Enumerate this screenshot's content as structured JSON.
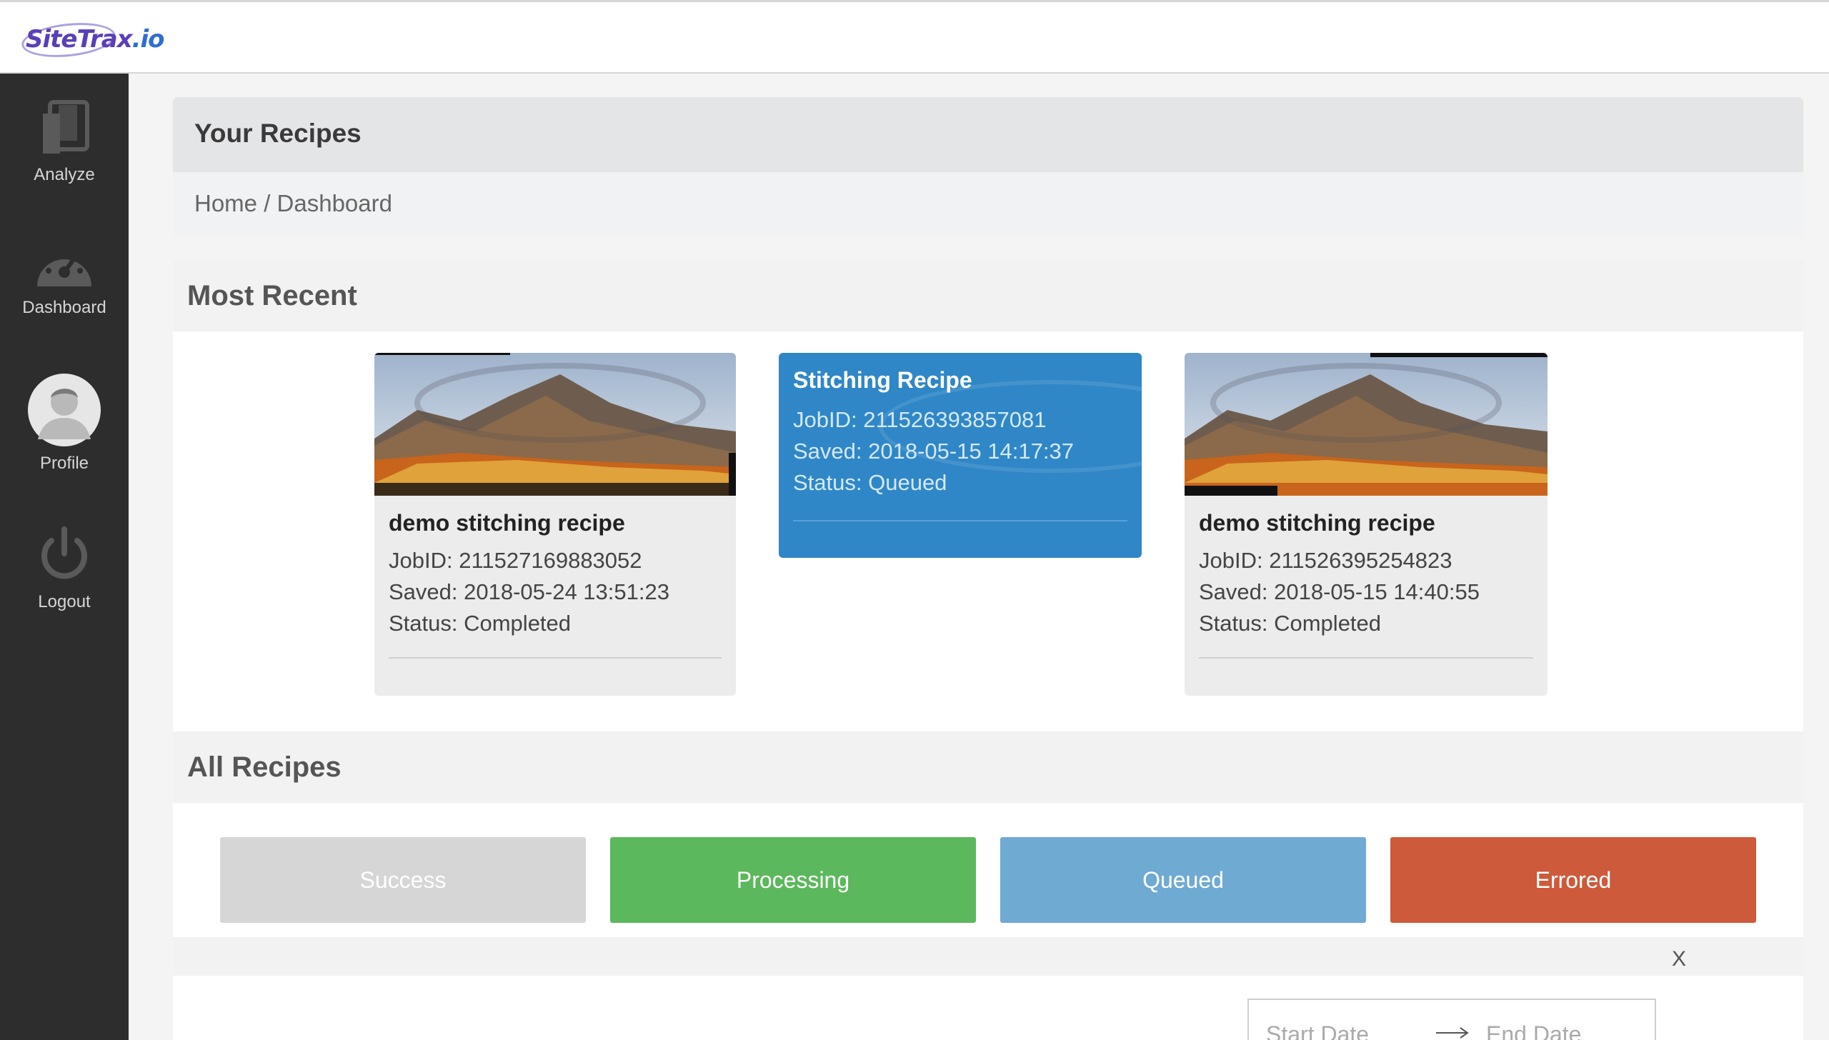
{
  "brand": {
    "logo_part1": "Site",
    "logo_part2": "Trax",
    "logo_part3": ".io"
  },
  "sidebar": {
    "items": [
      {
        "label": "Analyze",
        "icon": "copy-icon"
      },
      {
        "label": "Dashboard",
        "icon": "speedometer-icon"
      },
      {
        "label": "Profile",
        "icon": "avatar"
      },
      {
        "label": "Logout",
        "icon": "power-icon"
      }
    ]
  },
  "header": {
    "title": "Your Recipes",
    "breadcrumb": "Home / Dashboard"
  },
  "most_recent": {
    "title": "Most Recent",
    "cards": [
      {
        "title": "demo stitching recipe",
        "job_id": "JobID: 211527169883052",
        "saved": "Saved: 2018-05-24 13:51:23",
        "status": "Status: Completed"
      },
      {
        "title": "Stitching Recipe",
        "job_id": "JobID: 211526393857081",
        "saved": "Saved: 2018-05-15 14:17:37",
        "status": "Status: Queued"
      },
      {
        "title": "demo stitching recipe",
        "job_id": "JobID: 211526395254823",
        "saved": "Saved: 2018-05-15 14:40:55",
        "status": "Status: Completed"
      }
    ]
  },
  "all_recipes": {
    "title": "All Recipes",
    "filters": [
      {
        "label": "Success",
        "color": "#d6d6d6"
      },
      {
        "label": "Processing",
        "color": "#5cb85c"
      },
      {
        "label": "Queued",
        "color": "#6faad3"
      },
      {
        "label": "Errored",
        "color": "#cc5a3b"
      }
    ],
    "close_label": "X",
    "start_date_placeholder": "Start Date",
    "end_date_placeholder": "End Date"
  }
}
